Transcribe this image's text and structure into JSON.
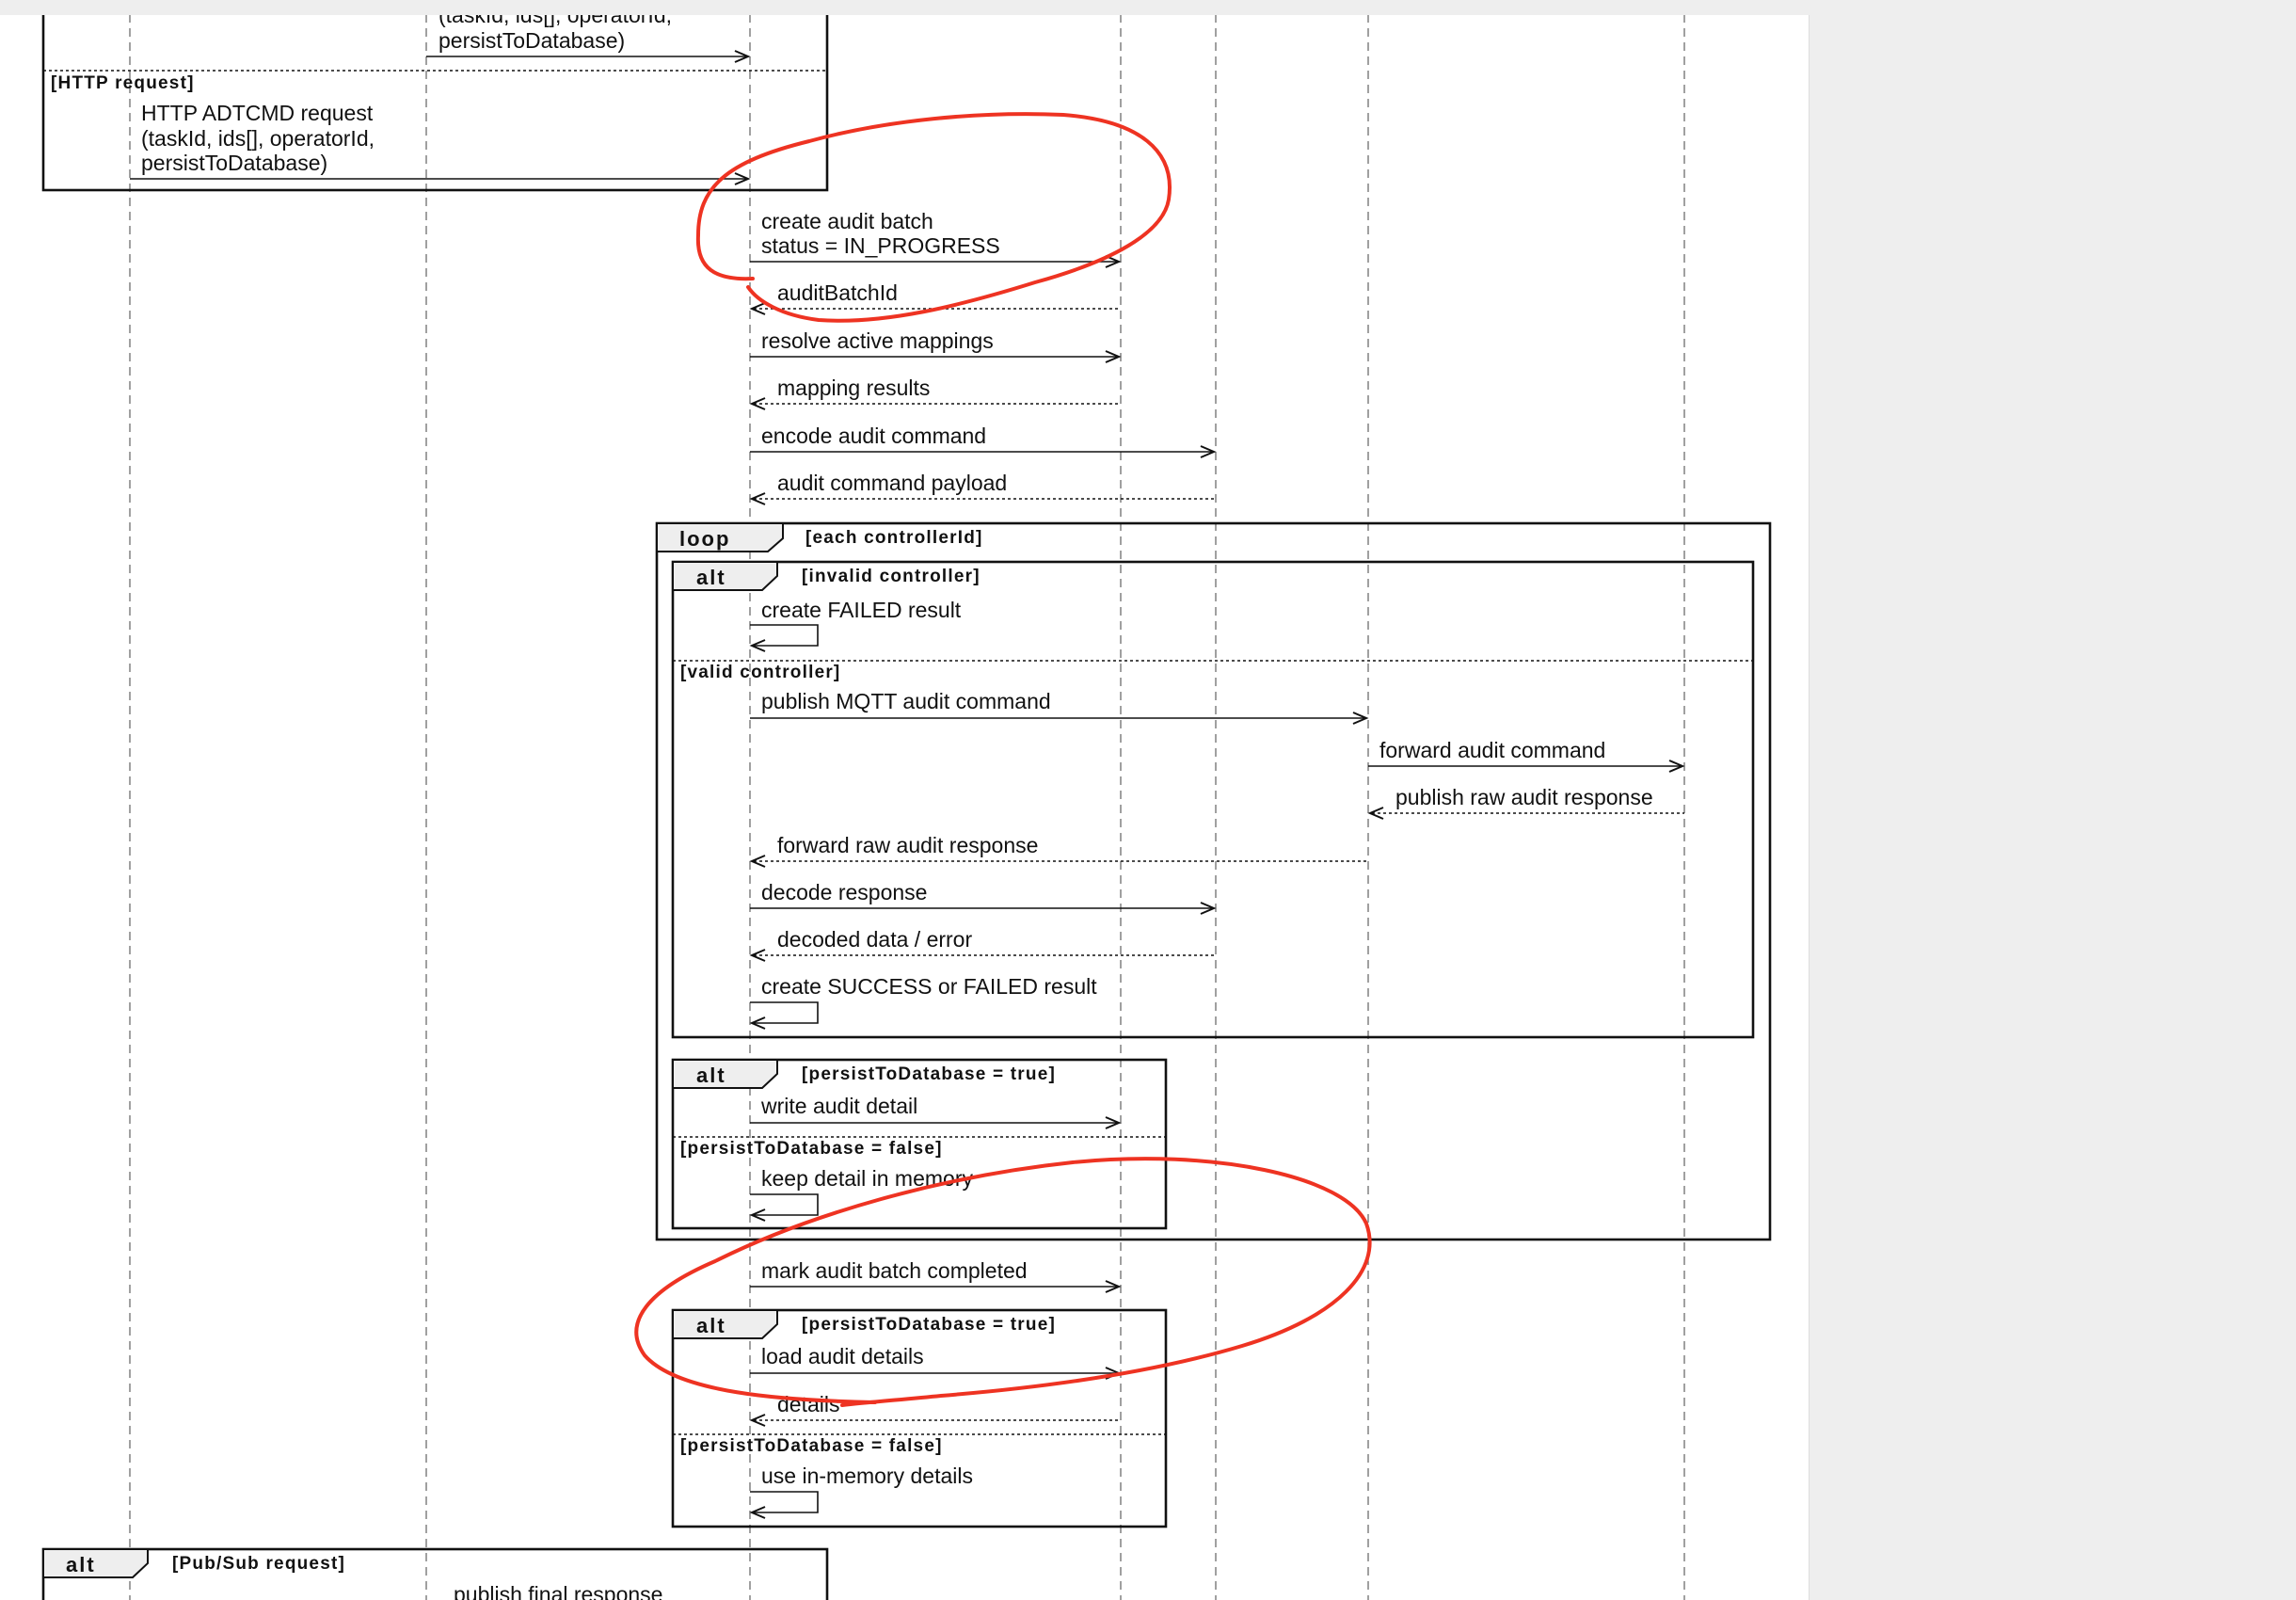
{
  "top_message": {
    "lines": [
      "(taskId, ids[], operatorId,",
      "persistToDatabase)"
    ]
  },
  "http_section": {
    "condition": "[HTTP request]",
    "message_lines": [
      "HTTP ADTCMD request",
      "(taskId, ids[], operatorId,",
      "persistToDatabase)"
    ]
  },
  "messages": {
    "create_batch_lines": [
      "create audit batch",
      "status = IN_PROGRESS"
    ],
    "audit_batch_id": "auditBatchId",
    "resolve_mappings": "resolve active mappings",
    "mapping_results": "mapping results",
    "encode_command": "encode audit command",
    "command_payload": "audit command payload",
    "mark_completed": "mark audit batch completed"
  },
  "loop": {
    "keyword": "loop",
    "condition": "[each controllerId]",
    "alt_controller": {
      "keyword": "alt",
      "condition": "[invalid controller]",
      "create_failed": "create FAILED result",
      "else_condition": "[valid controller]",
      "publish_mqtt": "publish MQTT audit command",
      "forward_command": "forward audit command",
      "publish_raw": "publish raw audit response",
      "forward_raw": "forward raw audit response",
      "decode_response": "decode response",
      "decoded_data": "decoded data / error",
      "create_result": "create SUCCESS or FAILED result"
    },
    "alt_persist": {
      "keyword": "alt",
      "condition": "[persistToDatabase = true]",
      "write_detail": "write audit detail",
      "else_condition": "[persistToDatabase = false]",
      "keep_memory": "keep detail in memory"
    }
  },
  "alt_load": {
    "keyword": "alt",
    "condition": "[persistToDatabase = true]",
    "load_details": "load audit details",
    "details": "details",
    "else_condition": "[persistToDatabase = false]",
    "use_memory": "use in-memory details"
  },
  "alt_pubsub": {
    "keyword": "alt",
    "condition": "[Pub/Sub request]",
    "publish_final": "publish final response"
  },
  "colors": {
    "annotation": "#ee3322",
    "line": "#111111",
    "lifeline": "#777777",
    "panel": "#eeeeee"
  }
}
